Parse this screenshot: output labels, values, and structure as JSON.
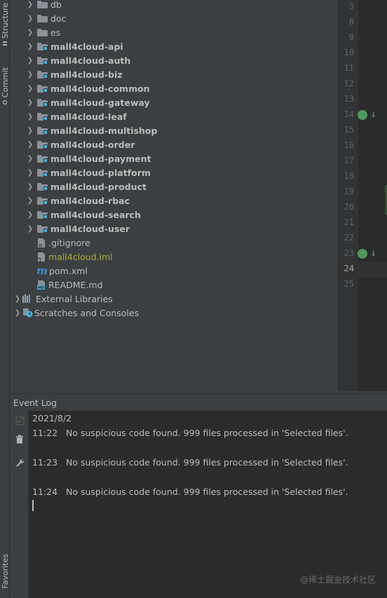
{
  "sidebar": {
    "tabs": [
      {
        "label": "Structure"
      },
      {
        "label": "Commit"
      },
      {
        "label": "Favorites"
      }
    ]
  },
  "project_tree": {
    "items": [
      {
        "label": "db",
        "type": "folder",
        "bold": false
      },
      {
        "label": "doc",
        "type": "folder",
        "bold": false
      },
      {
        "label": "es",
        "type": "folder",
        "bold": false
      },
      {
        "label": "mall4cloud-api",
        "type": "module",
        "bold": true
      },
      {
        "label": "mall4cloud-auth",
        "type": "module",
        "bold": true
      },
      {
        "label": "mall4cloud-biz",
        "type": "module",
        "bold": true
      },
      {
        "label": "mall4cloud-common",
        "type": "module",
        "bold": true
      },
      {
        "label": "mall4cloud-gateway",
        "type": "module",
        "bold": true
      },
      {
        "label": "mall4cloud-leaf",
        "type": "module",
        "bold": true
      },
      {
        "label": "mall4cloud-multishop",
        "type": "module",
        "bold": true
      },
      {
        "label": "mall4cloud-order",
        "type": "module",
        "bold": true
      },
      {
        "label": "mall4cloud-payment",
        "type": "module",
        "bold": true
      },
      {
        "label": "mall4cloud-platform",
        "type": "module",
        "bold": true
      },
      {
        "label": "mall4cloud-product",
        "type": "module",
        "bold": true
      },
      {
        "label": "mall4cloud-rbac",
        "type": "module",
        "bold": true
      },
      {
        "label": "mall4cloud-search",
        "type": "module",
        "bold": true
      },
      {
        "label": "mall4cloud-user",
        "type": "module",
        "bold": true
      },
      {
        "label": ".gitignore",
        "type": "file"
      },
      {
        "label": "mall4cloud.iml",
        "type": "iml"
      },
      {
        "label": "pom.xml",
        "type": "maven"
      },
      {
        "label": "README.md",
        "type": "markdown"
      }
    ],
    "external_libraries": "External Libraries",
    "scratches": "Scratches and Consoles"
  },
  "gutter": {
    "line_numbers": [
      "3",
      "8",
      "9",
      "10",
      "11",
      "12",
      "13",
      "14",
      "15",
      "16",
      "17",
      "18",
      "19",
      "20",
      "21",
      "22",
      "23",
      "24",
      "25"
    ],
    "current_line": "24"
  },
  "event_log": {
    "title": "Event Log",
    "date": "2021/8/2",
    "entries": [
      {
        "time": "11:22",
        "message": "No suspicious code found. 999 files processed in 'Selected files'."
      },
      {
        "time": "11:23",
        "message": "No suspicious code found. 999 files processed in 'Selected files'."
      },
      {
        "time": "11:24",
        "message": "No suspicious code found. 999 files processed in 'Selected files'."
      }
    ]
  },
  "watermark": "@稀土掘金技术社区",
  "colors": {
    "module_marker": "#40b6e0",
    "ignored_file": "#a8b03a",
    "maven_icon": "#3d8fd6",
    "gutter_marker": "#4c9a5a"
  }
}
